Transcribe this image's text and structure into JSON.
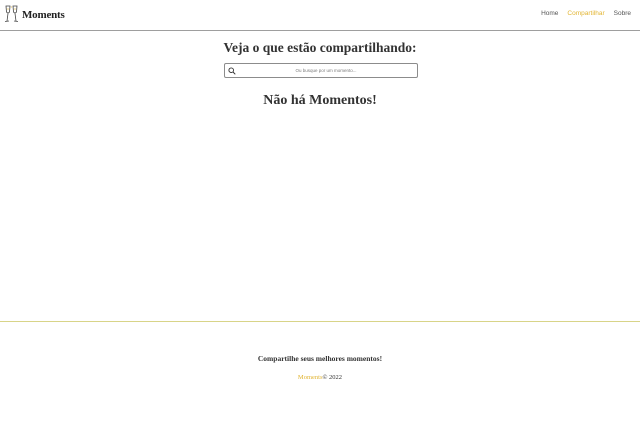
{
  "navbar": {
    "brand_name": "Moments",
    "logo_icon": "champagne-toast-icon",
    "links": [
      {
        "label": "Home",
        "active": false
      },
      {
        "label": "Compartilhar",
        "active": true
      },
      {
        "label": "Sobre",
        "active": false
      }
    ]
  },
  "main": {
    "title": "Veja o que estão compartilhando:",
    "search": {
      "placeholder": "Ou busque por um momento...",
      "value": ""
    },
    "empty_message": "Não há Momentos!"
  },
  "footer": {
    "tagline": "Compartilhe seus melhores momentos!",
    "brand": "Moments",
    "copyright": "© 2022"
  },
  "colors": {
    "accent": "#e2b533",
    "text": "#333333",
    "nav_border": "#9e9e9e",
    "footer_border": "#d8d488"
  }
}
